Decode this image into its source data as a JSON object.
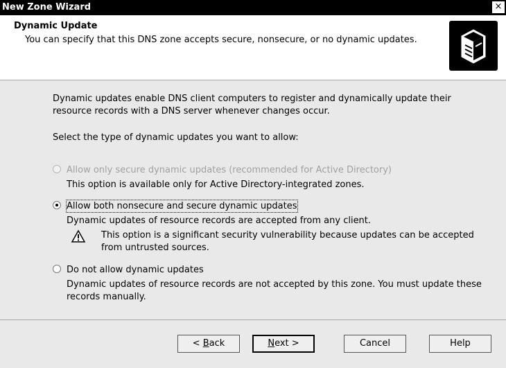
{
  "window": {
    "title": "New Zone Wizard",
    "close_glyph": "×"
  },
  "header": {
    "title": "Dynamic Update",
    "subtitle": "You can specify that this DNS zone accepts secure, nonsecure, or no dynamic updates.",
    "icon": "dns-server-icon"
  },
  "body": {
    "intro": "Dynamic updates enable DNS client computers to register and dynamically update their resource records with a DNS server whenever changes occur.",
    "prompt": "Select the type of dynamic updates you want to allow:",
    "options": [
      {
        "label": "Allow only secure dynamic updates (recommended for Active Directory)",
        "description": "This option is available only for Active Directory-integrated zones.",
        "enabled": false,
        "checked": false
      },
      {
        "label": "Allow both nonsecure and secure dynamic updates",
        "description": "Dynamic updates of resource records are accepted from any client.",
        "warning": "This option is a significant security vulnerability because updates can be accepted from untrusted sources.",
        "warning_icon": "warning-triangle-icon",
        "enabled": true,
        "checked": true
      },
      {
        "label": "Do not allow dynamic updates",
        "description": "Dynamic updates of resource records are not accepted by this zone. You must update these records manually.",
        "enabled": true,
        "checked": false
      }
    ]
  },
  "footer": {
    "back_prefix": "< ",
    "back_key": "B",
    "back_rest": "ack",
    "next_key": "N",
    "next_rest": "ext >",
    "cancel": "Cancel",
    "help": "Help"
  }
}
